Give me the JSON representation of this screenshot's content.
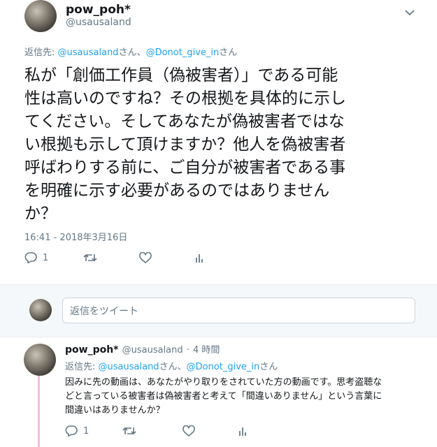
{
  "tweet": {
    "display_name": "pow_poh*",
    "handle": "@usausaland",
    "menu_icon": "chevron-down-icon",
    "reply_prefix": "返信先:",
    "reply_user1": "@usausaland",
    "reply_san1": "さん、",
    "reply_user2": "@Donot_give_in",
    "reply_san2": "さん",
    "text_lines": [
      "私が「創価工作員（偽被害者）」である可能",
      "性は高いのですね？その根拠を具体的に示し",
      "てください。そしてあなたが偽被害者ではな",
      "い根拠も示して頂けますか？他人を偽被害者",
      "呼ばわりする前に、ご自分が被害者である事",
      "を明確に示す必要があるのではありません",
      "か？"
    ],
    "timestamp": "16:41 - 2018年3月16日",
    "reply_count": "1"
  },
  "reply_box": {
    "placeholder": "返信をツイート"
  },
  "reply_tweet": {
    "display_name": "pow_poh*",
    "handle": "@usausaland",
    "separator": "·",
    "age": "4 時間",
    "reply_prefix": "返信先:",
    "reply_user1": "@usausaland",
    "reply_san1": "さん、",
    "reply_user2": "@Donot_give_in",
    "reply_san2": "さん",
    "text_lines": [
      "因みに先の動画は、あなたがやり取りをされていた方の動画です。思考盗聴な",
      "どと言っている被害者は偽被害者と考えて「間違いありません」という言葉に",
      "間違いはありませんか？"
    ],
    "reply_count": "1"
  },
  "icons": [
    "reply-icon",
    "retweet-icon",
    "like-icon",
    "analytics-icon"
  ],
  "colors": {
    "link": "#1da1f2",
    "muted": "#657786",
    "thread_line": "#e8c2de",
    "band": "#f5f8fa"
  }
}
